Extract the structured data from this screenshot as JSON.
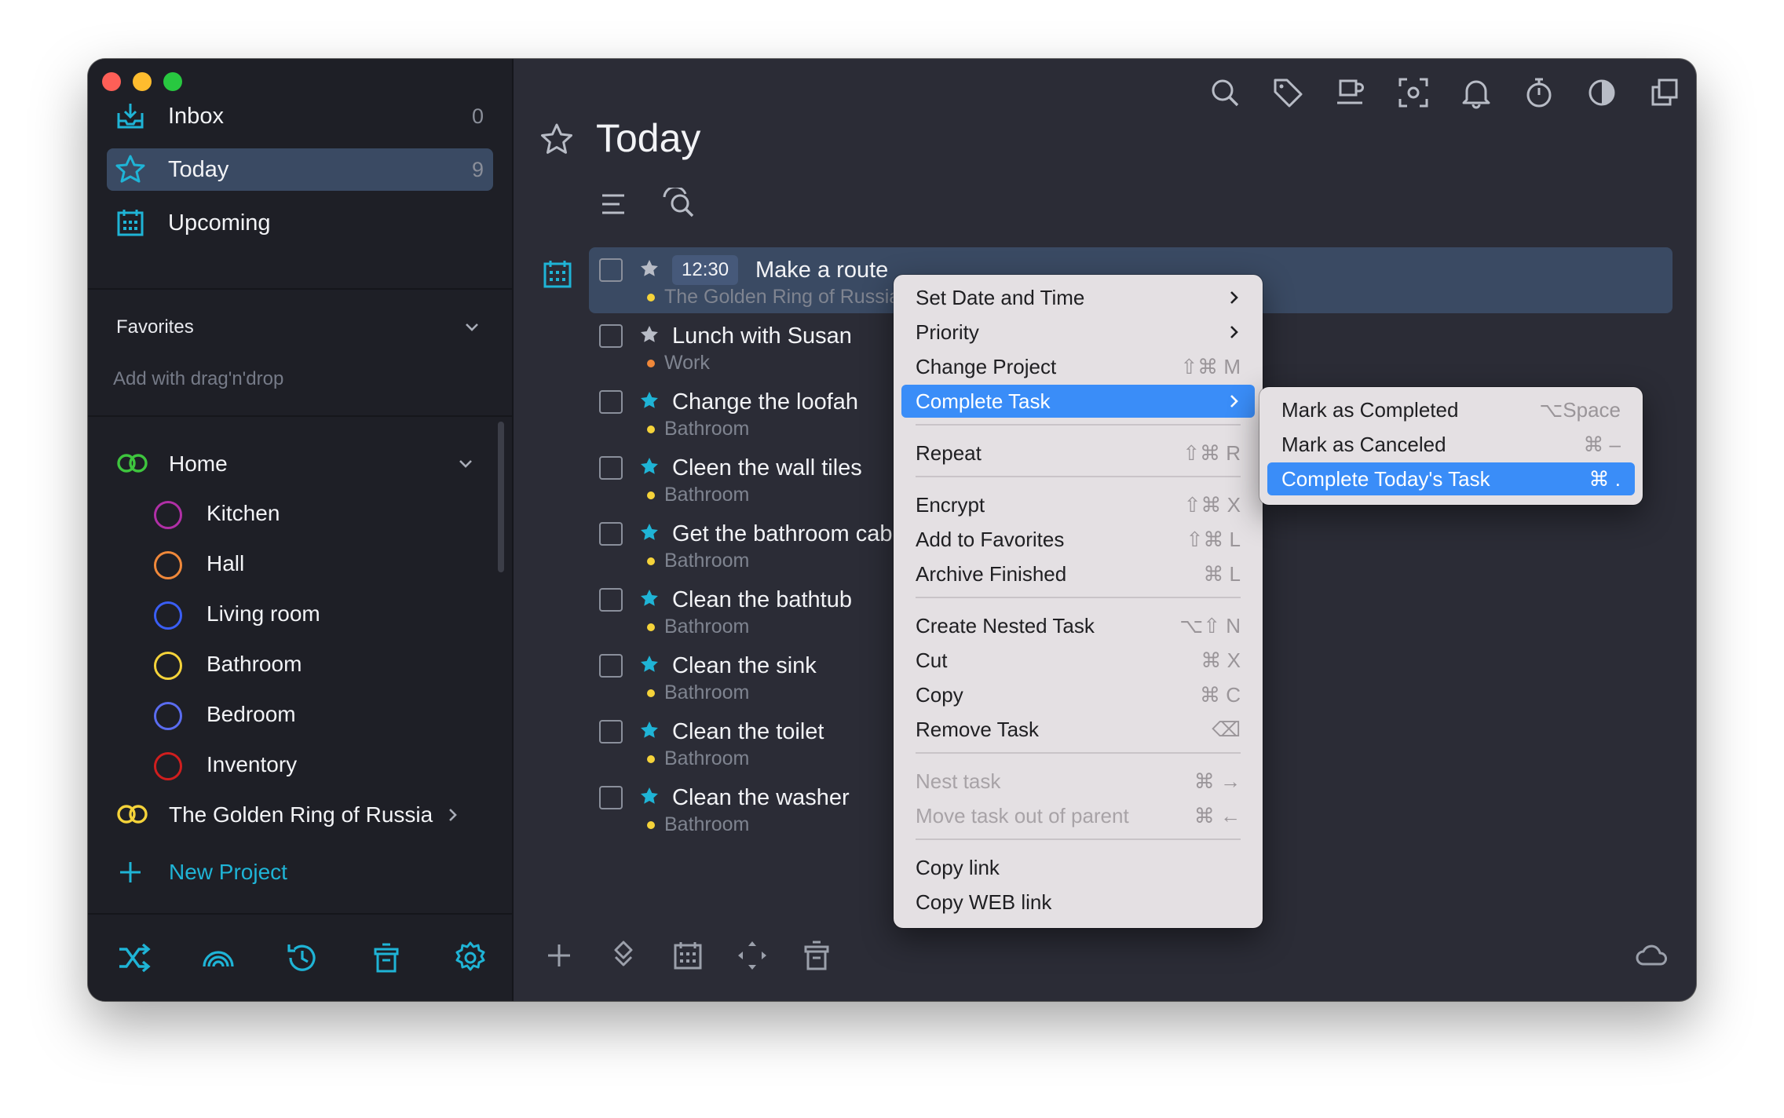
{
  "colors": {
    "accent": "#1fb4d6",
    "selection": "#3a4a63",
    "menu_highlight": "#3a8df8",
    "yellow": "#f5d33a",
    "orange": "#f0883a"
  },
  "sidebar": {
    "nav": [
      {
        "label": "Inbox",
        "count": "0",
        "icon": "inbox-tray-icon"
      },
      {
        "label": "Today",
        "count": "9",
        "icon": "star-icon"
      },
      {
        "label": "Upcoming",
        "count": "",
        "icon": "calendar-icon"
      }
    ],
    "favorites": {
      "title": "Favorites",
      "hint": "Add with drag'n'drop"
    },
    "projects": {
      "home": "Home",
      "children": [
        {
          "label": "Kitchen",
          "color": "#b02fa6"
        },
        {
          "label": "Hall",
          "color": "#f0883a"
        },
        {
          "label": "Living room",
          "color": "#3a5ef5"
        },
        {
          "label": "Bathroom",
          "color": "#f5d33a"
        },
        {
          "label": "Bedroom",
          "color": "#5a6cf0"
        },
        {
          "label": "Inventory",
          "color": "#d01e1e"
        }
      ],
      "golden": "The Golden Ring of Russia",
      "new_project": "New Project"
    }
  },
  "main": {
    "title": "Today",
    "tasks": [
      {
        "time": "12:30",
        "title": "Make a route",
        "project": "The Golden Ring of Russia",
        "dot": "#f5d33a",
        "starred": false
      },
      {
        "title": "Lunch with Susan",
        "project": "Work",
        "dot": "#f0883a",
        "starred": false
      },
      {
        "title": "Change the loofah",
        "project": "Bathroom",
        "dot": "#f5d33a",
        "starred": true
      },
      {
        "title": "Cleen the wall tiles",
        "project": "Bathroom",
        "dot": "#f5d33a",
        "starred": true
      },
      {
        "title": "Get the bathroom cabinet",
        "project": "Bathroom",
        "dot": "#f5d33a",
        "starred": true
      },
      {
        "title": "Clean the bathtub",
        "project": "Bathroom",
        "dot": "#f5d33a",
        "starred": true
      },
      {
        "title": "Clean the sink",
        "project": "Bathroom",
        "dot": "#f5d33a",
        "starred": true
      },
      {
        "title": "Clean the toilet",
        "project": "Bathroom",
        "dot": "#f5d33a",
        "starred": true
      },
      {
        "title": "Clean the washer",
        "project": "Bathroom",
        "dot": "#f5d33a",
        "starred": true
      }
    ]
  },
  "context_menu": {
    "items": [
      {
        "label": "Set Date and Time",
        "shortcut": ""
      },
      {
        "label": "Priority",
        "shortcut": ""
      },
      {
        "label": "Change Project",
        "shortcut": "⇧⌘ M"
      },
      {
        "label": "Complete Task",
        "shortcut": ""
      },
      {
        "label": "Repeat",
        "shortcut": "⇧⌘ R"
      },
      {
        "label": "Encrypt",
        "shortcut": "⇧⌘ X"
      },
      {
        "label": "Add to Favorites",
        "shortcut": "⇧⌘ L"
      },
      {
        "label": "Archive Finished",
        "shortcut": "⌘ L"
      },
      {
        "label": "Create Nested Task",
        "shortcut": "⌥⇧ N"
      },
      {
        "label": "Cut",
        "shortcut": "⌘ X"
      },
      {
        "label": "Copy",
        "shortcut": "⌘ C"
      },
      {
        "label": "Remove Task",
        "shortcut": "⌫"
      },
      {
        "label": "Nest task",
        "shortcut": "⌘ →"
      },
      {
        "label": "Move task out of parent",
        "shortcut": "⌘ ←"
      },
      {
        "label": "Copy link",
        "shortcut": ""
      },
      {
        "label": "Copy WEB link",
        "shortcut": ""
      }
    ]
  },
  "submenu": {
    "items": [
      {
        "label": "Mark as Completed",
        "shortcut": "⌥Space"
      },
      {
        "label": "Mark as Canceled",
        "shortcut": "⌘ –"
      },
      {
        "label": "Complete Today's Task",
        "shortcut": "⌘ ."
      }
    ]
  }
}
